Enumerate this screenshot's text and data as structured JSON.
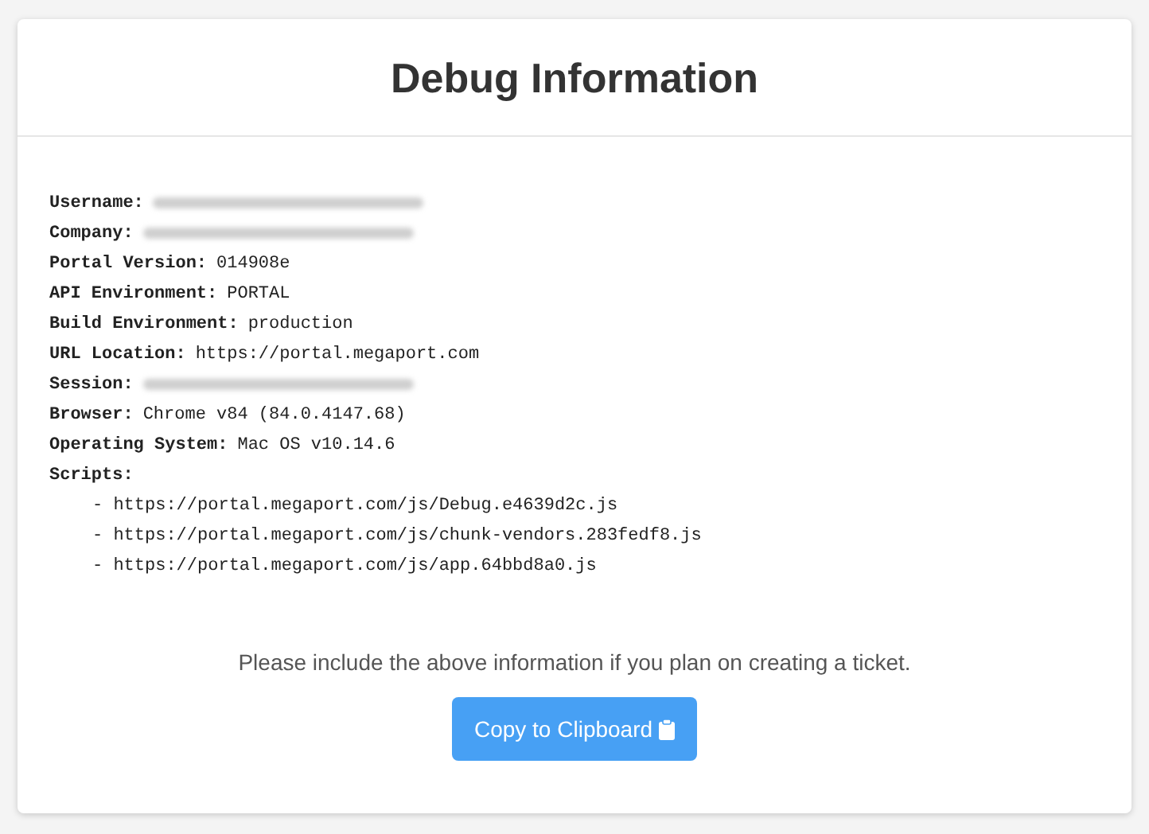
{
  "title": "Debug Information",
  "fields": [
    {
      "label": "Username:",
      "redacted": true
    },
    {
      "label": "Company:",
      "redacted": true
    },
    {
      "label": "Portal Version:",
      "redacted": false,
      "value": "014908e"
    },
    {
      "label": "API Environment:",
      "redacted": false,
      "value": "PORTAL"
    },
    {
      "label": "Build Environment:",
      "redacted": false,
      "value": "production"
    },
    {
      "label": "URL Location:",
      "redacted": false,
      "value": "https://portal.megaport.com"
    },
    {
      "label": "Session:",
      "redacted": true
    },
    {
      "label": "Browser:",
      "redacted": false,
      "value": "Chrome v84 (84.0.4147.68)"
    },
    {
      "label": "Operating System:",
      "redacted": false,
      "value": "Mac OS v10.14.6"
    },
    {
      "label": "Scripts:",
      "redacted": false
    }
  ],
  "scripts": [
    "- https://portal.megaport.com/js/Debug.e4639d2c.js",
    "- https://portal.megaport.com/js/chunk-vendors.283fedf8.js",
    "- https://portal.megaport.com/js/app.64bbd8a0.js"
  ],
  "note": "Please include the above information if you plan on creating a ticket.",
  "button": {
    "label": "Copy to Clipboard"
  }
}
